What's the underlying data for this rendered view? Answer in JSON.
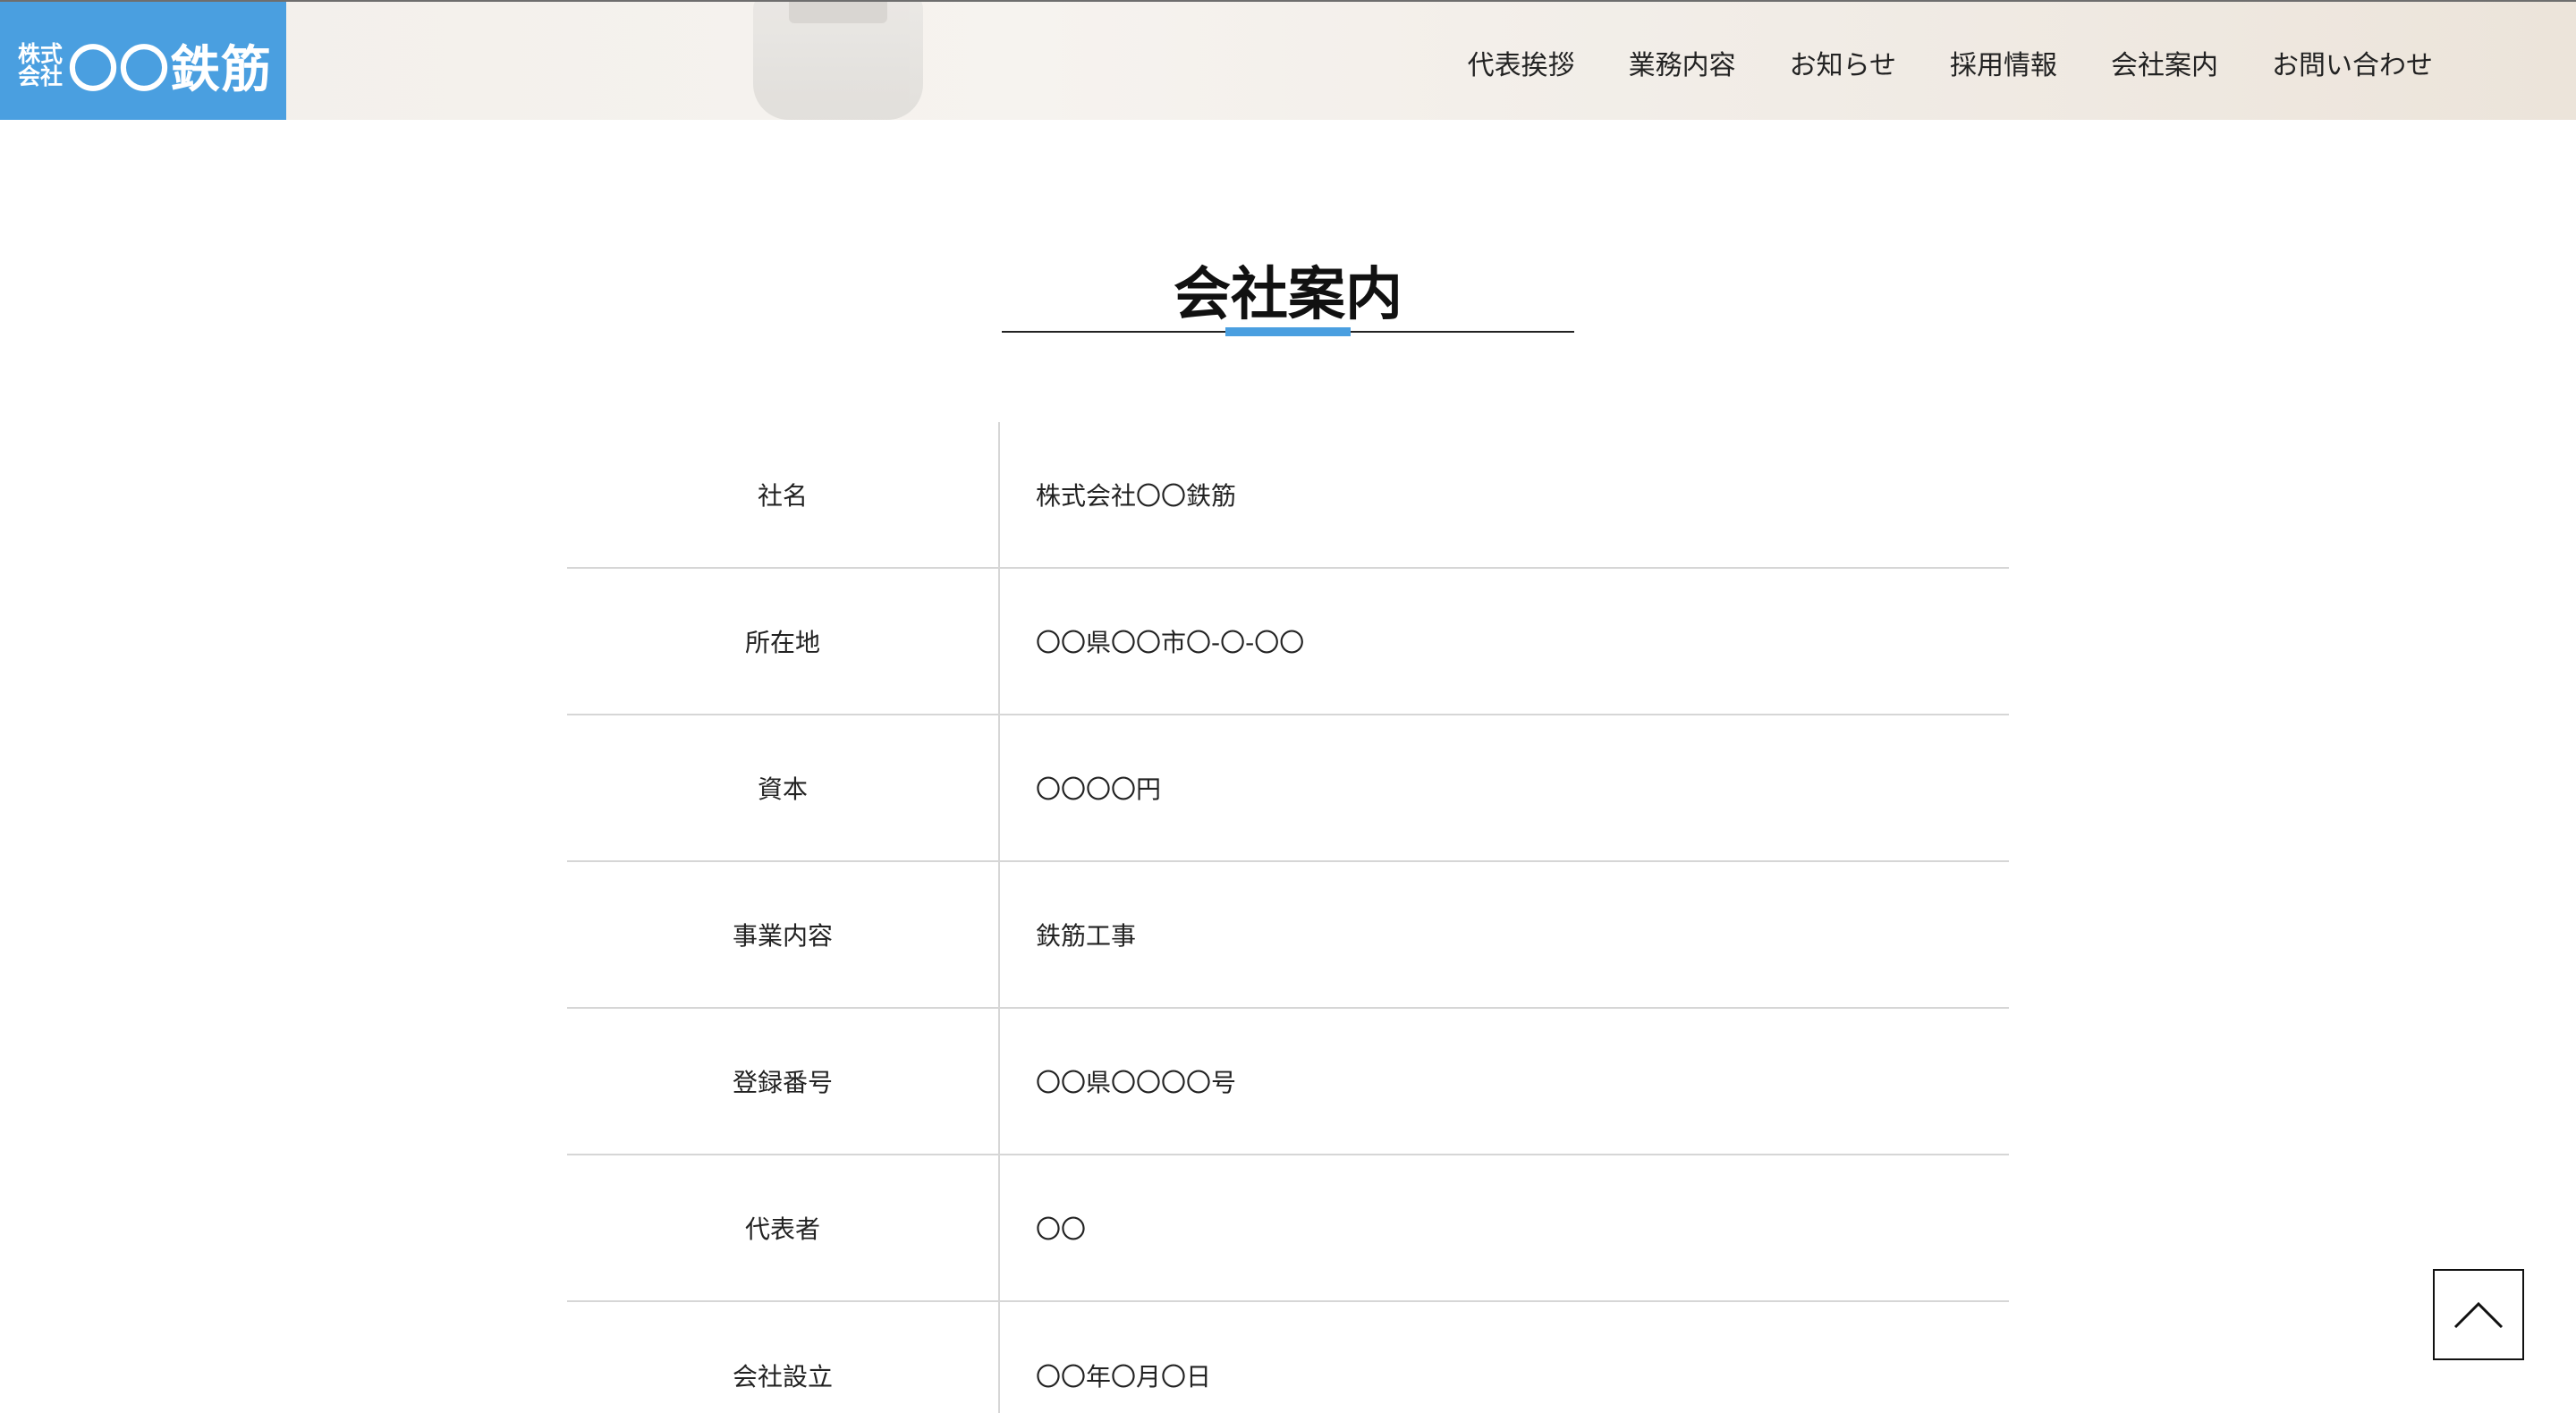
{
  "logo": {
    "small_line1": "株式",
    "small_line2": "会社",
    "name": "〇〇鉄筋"
  },
  "nav": {
    "items": [
      "代表挨拶",
      "業務内容",
      "お知らせ",
      "採用情報",
      "会社案内",
      "お問い合わせ"
    ]
  },
  "page": {
    "title": "会社案内"
  },
  "colors": {
    "accent": "#4a9fe0"
  },
  "company_table": {
    "rows": [
      {
        "label": "社名",
        "value": "株式会社〇〇鉄筋"
      },
      {
        "label": "所在地",
        "value": "〇〇県〇〇市〇-〇-〇〇"
      },
      {
        "label": "資本",
        "value": "〇〇〇〇円"
      },
      {
        "label": "事業内容",
        "value": "鉄筋工事"
      },
      {
        "label": "登録番号",
        "value": "〇〇県〇〇〇〇号"
      },
      {
        "label": "代表者",
        "value": "〇〇"
      },
      {
        "label": "会社設立",
        "value": "〇〇年〇月〇日"
      }
    ]
  },
  "back_to_top": {
    "icon": "chevron-up-icon"
  }
}
